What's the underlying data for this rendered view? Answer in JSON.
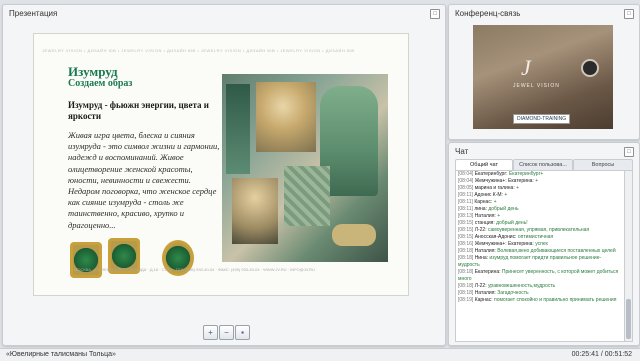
{
  "presentation": {
    "title": "Презентация",
    "slide": {
      "topband": "JEWELRY VISION • ДИЗАЙН ЮВ • JEWELRY VISION • ДИЗАЙН ЮВ • JEWELRY VISION • ДИЗАЙН ЮВ • JEWELRY VISION • ДИЗАЙН ЮВ",
      "title_line1": "Изумруд",
      "title_line2": "Создаем образ",
      "subtitle": "Изумруд - фьюжн энергии, цвета и яркости",
      "body": "Живая игра цвета, блеска и сияния изумруда - это символ жизни и гармонии, надежд и воспоминаний. Живое олицетворение женской красоты, юности, невинности и свежести. Недаром поговорка, что женское сердце как сияние изумруда - столь же таинственно, красиво, хрупко и драгоценно...",
      "footer": "МОСКВА · УЛ. ЗЕЛЕНСКАЯ СЛОБОДА · Д.16 · СТР.4 · ТЕЛ: (495) 933-40-04 · ФАКС: (495) 933-40-04 · WWW.JV.RU · INFO@JV.RU"
    }
  },
  "conference": {
    "title": "Конференц-связь",
    "logo": "J",
    "logo_sub": "JEWEL VISION",
    "label": "DIAMOND-TRAINING"
  },
  "chat": {
    "title": "Чат",
    "tabs": [
      "Общий чат",
      "Список пользова...",
      "Вопросы"
    ],
    "messages": [
      {
        "time": "[08:04]",
        "user": "Екатеринбург:",
        "text": "Екатеринбург+"
      },
      {
        "time": "[08:04]",
        "user": "Жемчужина+: Екатерина:",
        "text": "+"
      },
      {
        "time": "[08:05]",
        "user": "марина и галина:",
        "text": "+"
      },
      {
        "time": "[08:11]",
        "user": "Адонис К-М:",
        "text": "+"
      },
      {
        "time": "[08:11]",
        "user": "Карнас:",
        "text": "+"
      },
      {
        "time": "[08:11]",
        "user": "лина:",
        "text": "добрый день"
      },
      {
        "time": "[08:13]",
        "user": "Наталия:",
        "text": "+"
      },
      {
        "time": "[08:15]",
        "user": "станция:",
        "text": "добрый день!"
      },
      {
        "time": "[08:15]",
        "user": "Л-22:",
        "text": "самоуверенная, упрямая, привлекательная"
      },
      {
        "time": "[08:15]",
        "user": "Аносская-Адонис:",
        "text": "оптимистичная"
      },
      {
        "time": "[08:16]",
        "user": "Жемчужина+: Екатерина:",
        "text": "успех"
      },
      {
        "time": "[08:18]",
        "user": "Наталия:",
        "text": "Волевая,вено добивающиеся поставленных целей"
      },
      {
        "time": "[08:18]",
        "user": "Нина:",
        "text": "изумруд помогает придти правильное решение- мудрость"
      },
      {
        "time": "[08:18]",
        "user": "Екатерина:",
        "text": "Принесет уверенность, с которой может добиться много"
      },
      {
        "time": "[08:18]",
        "user": "Л-22:",
        "text": "уравновешенность,мудрость"
      },
      {
        "time": "[08:18]",
        "user": "Наталия:",
        "text": "Загадочность"
      },
      {
        "time": "[08:19]",
        "user": "Карнас:",
        "text": "помогает спокойно и правильно принимать решения"
      }
    ]
  },
  "toolbar": {
    "zoom_in": "+",
    "zoom_out": "−",
    "save": "▪"
  },
  "status": {
    "left": "«Ювелирные талисманы Тольца»",
    "right": "00:25:41 / 00:51:52"
  }
}
